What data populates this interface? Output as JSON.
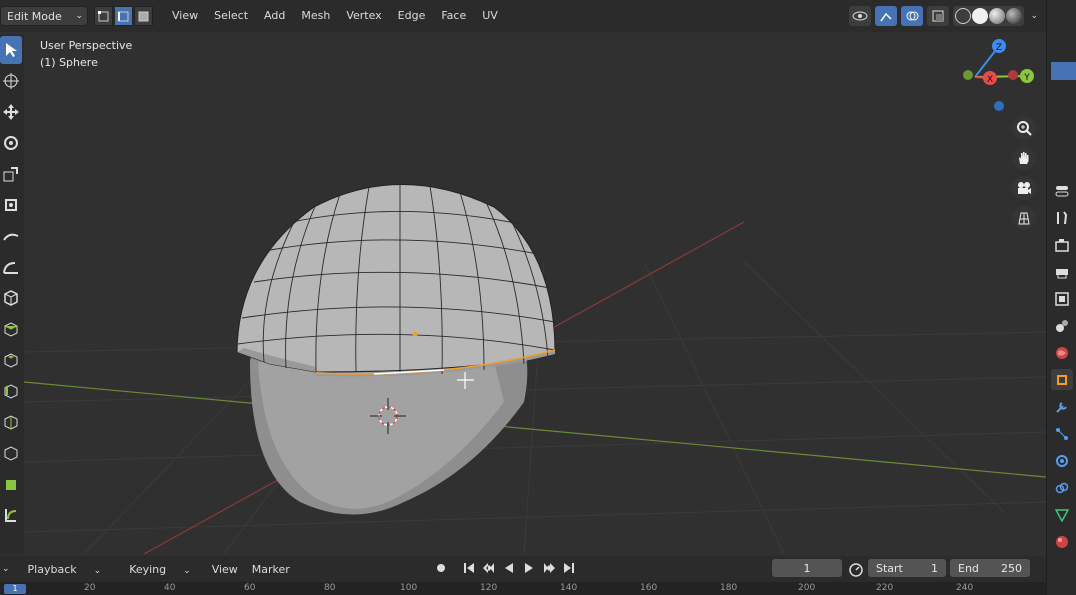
{
  "header": {
    "mode": "Edit Mode",
    "menus": [
      "View",
      "Select",
      "Add",
      "Mesh",
      "Vertex",
      "Edge",
      "Face",
      "UV"
    ]
  },
  "viewport": {
    "perspective": "User Perspective",
    "object": "(1) Sphere",
    "gizmo": {
      "x": "X",
      "y": "Y",
      "z": "Z"
    }
  },
  "timeline": {
    "menus": [
      "Playback",
      "Keying",
      "View",
      "Marker"
    ],
    "current_frame": "1",
    "start_label": "Start",
    "start_value": "1",
    "end_label": "End",
    "end_value": "250",
    "ruler": [
      "20",
      "40",
      "60",
      "80",
      "100",
      "120",
      "140",
      "160",
      "180",
      "200",
      "220",
      "240"
    ],
    "ruler_current": "1"
  },
  "colors": {
    "accent": "#4772b3",
    "x_axis": "#e84b4b",
    "y_axis": "#8cc63f",
    "z_axis": "#3d8cf0",
    "selection": "#f59c2a"
  }
}
